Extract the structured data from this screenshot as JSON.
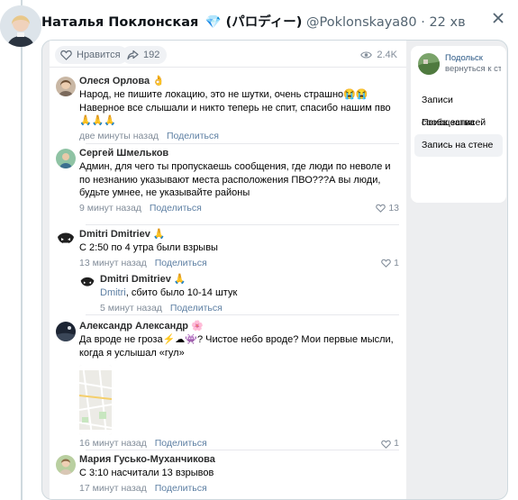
{
  "tweet": {
    "display_name": "Наталья Поклонская",
    "name_suffix": " 💎 (パロディー)",
    "handle": "@Poklonskaya80",
    "separator": " · ",
    "time": "22 хв"
  },
  "post_stats": {
    "like_label": "Нравится",
    "share_count": "192",
    "views": "2.4K"
  },
  "comments": [
    {
      "author": "Олеся Орлова 👌",
      "text": "Народ, не пишите локацию, это не шутки, очень страшно😭😭 Наверное все слышали и никто теперь не спит, спасибо нашим пво🙏🙏🙏",
      "time": "две минуты назад",
      "reply_label": "Поделиться",
      "likes": ""
    },
    {
      "author": "Сергей Шмельков",
      "text": "Админ, для чего ты пропускаешь сообщения, где люди по неволе и по незнанию указывают места расположения ПВО???А вы люди, будьте умнее, не указывайте районы",
      "time": "9 минут назад",
      "reply_label": "Поделиться",
      "likes": "13"
    },
    {
      "author": "Dmitri Dmitriev 🙏",
      "text": "С 2:50 по 4 утра были взрывы",
      "time": "13 минут назад",
      "reply_label": "Поделиться",
      "likes": "1"
    },
    {
      "author": "Dmitri Dmitriev 🙏",
      "reply_to": "Dmitri",
      "text": ", сбито было 10-14 штук",
      "time": "5 минут назад",
      "reply_label": "Поделиться",
      "likes": ""
    },
    {
      "author": "Александр Александр 🌸",
      "text": "Да вроде не гроза⚡☁👾? Чистое небо вроде? Мои первые мысли, когда я услышал «гул»",
      "time": "16 минут назад",
      "reply_label": "Поделиться",
      "likes": "1"
    },
    {
      "author": "Мария Гусько-Муханчикова",
      "text": "С 3:10 насчитали 13 взрывов",
      "time": "17 минут назад",
      "reply_label": "Поделиться",
      "likes": ""
    }
  ],
  "sidebar": {
    "community_name": "Подольск",
    "back_label": "вернуться к стран…",
    "items": [
      {
        "label": "Записи сообщества"
      },
      {
        "label": "Поиск записей"
      },
      {
        "label": "Запись на стене"
      }
    ]
  },
  "colors": {
    "vk_link": "#2a5885",
    "meta_link": "#5d7fa3",
    "page_bg": "#edeef0"
  }
}
